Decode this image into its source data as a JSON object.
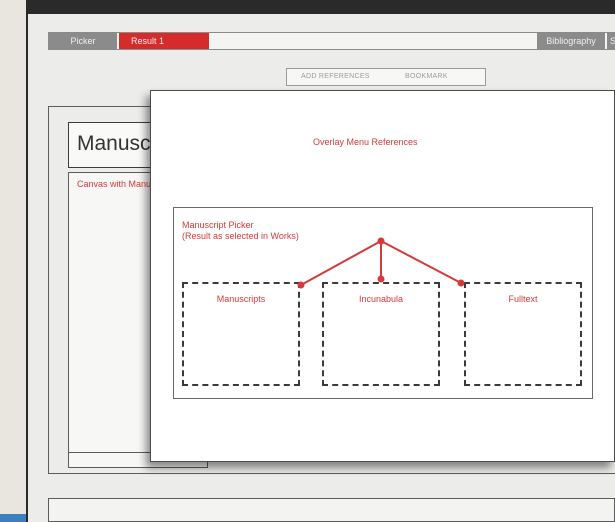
{
  "nav_tabs": {
    "picker": "Picker",
    "result": "Result 1",
    "bibliography": "Bibliography",
    "s": "S"
  },
  "subtabs": {
    "add": "ADD REFERENCES",
    "bookmark": "BOOKMARK"
  },
  "main": {
    "title": "Manuscript",
    "canvas_label": "Canvas with Manuscript"
  },
  "overlay": {
    "title": "Overlay Menu References",
    "picker_title_line1": "Manuscript Picker",
    "picker_title_line2": "(Result as selected in Works)",
    "boxes": [
      "Manuscripts",
      "Incunabula",
      "Fulltext"
    ]
  },
  "colors": {
    "accent": "#d62b2b",
    "annotation": "#d43a3a",
    "tab_gray": "#8b8b8b"
  }
}
